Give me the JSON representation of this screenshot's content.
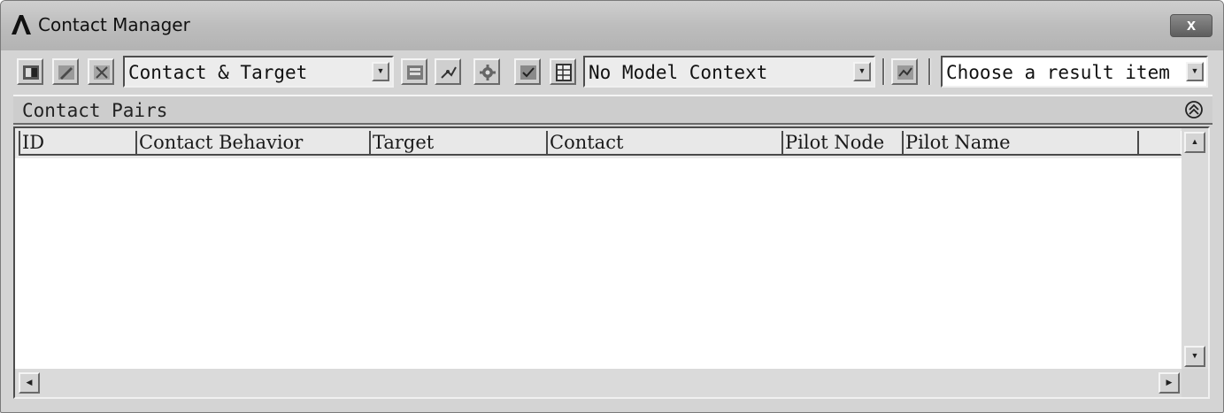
{
  "window": {
    "title": "Contact Manager",
    "close_label": "x"
  },
  "toolbar": {
    "filter_dropdown": "Contact & Target",
    "context_dropdown": "No Model Context",
    "result_dropdown": "Choose a result item"
  },
  "section": {
    "title": "Contact Pairs"
  },
  "table": {
    "columns": [
      "ID",
      "Contact Behavior",
      "Target",
      "Contact",
      "Pilot Node",
      "Pilot Name",
      ""
    ]
  },
  "icons": {
    "app_logo": "ansys-logo-icon",
    "collapse": "collapse-up-icon",
    "dropdown": "dropdown-arrow-icon",
    "scroll_up": "scroll-up-icon",
    "scroll_down": "scroll-down-icon",
    "scroll_left": "scroll-left-icon",
    "scroll_right": "scroll-right-icon"
  }
}
